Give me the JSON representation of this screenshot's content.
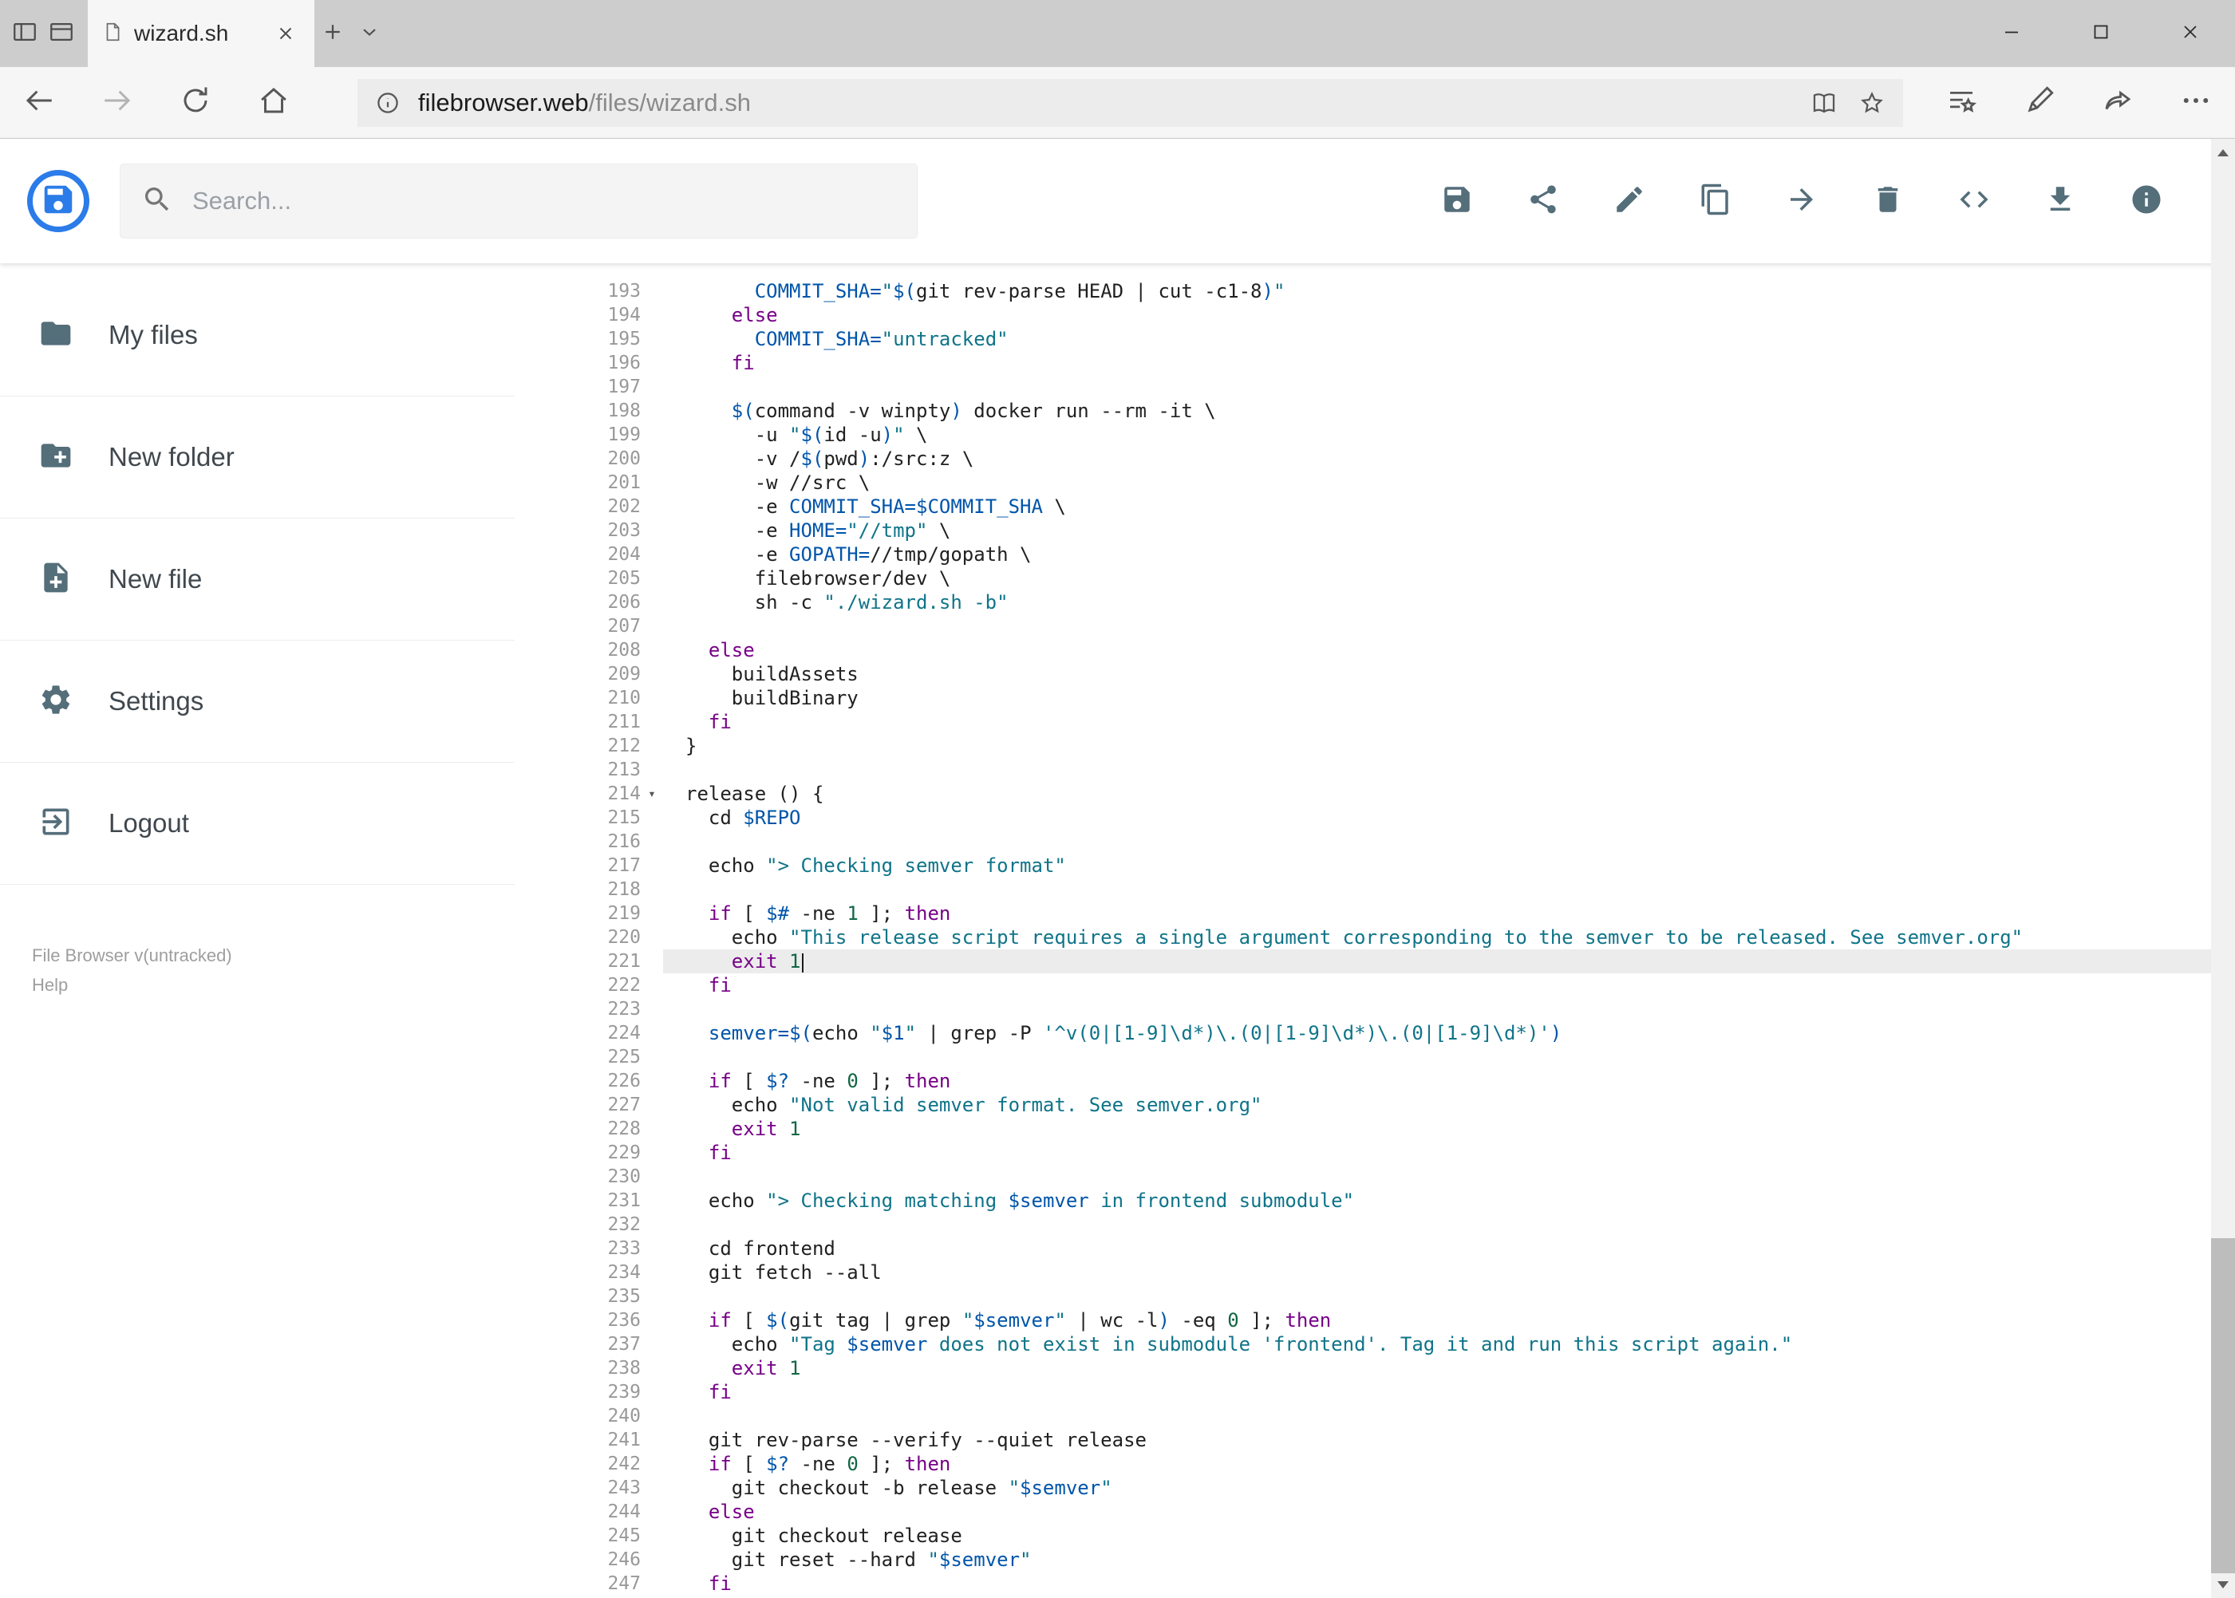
{
  "colors": {
    "accent": "#2b7ce9",
    "toolbar_icon": "#546e7a",
    "syntax_keyword": "#770088",
    "syntax_variable": "#0055aa",
    "syntax_string": "#0f7489",
    "syntax_number": "#116644",
    "active_line_bg": "#ececec"
  },
  "browser": {
    "tab": {
      "title": "wizard.sh"
    },
    "address": {
      "host": "filebrowser.web",
      "path": "/files/wizard.sh"
    },
    "nav_icons": [
      "back",
      "forward",
      "refresh",
      "home"
    ],
    "address_icons": [
      "site-info",
      "reading-view",
      "add-favorite"
    ],
    "action_icons": [
      "hub",
      "web-note",
      "share",
      "more"
    ],
    "window_controls": [
      "minimize",
      "maximize",
      "close"
    ]
  },
  "app": {
    "search_placeholder": "Search...",
    "toolbar_icons": [
      "save",
      "share",
      "rename",
      "copy",
      "move",
      "delete",
      "raw-view",
      "download",
      "info"
    ]
  },
  "sidebar": {
    "items": [
      {
        "label": "My files",
        "icon": "folder"
      },
      {
        "label": "New folder",
        "icon": "create-new-folder"
      },
      {
        "label": "New file",
        "icon": "note-add"
      },
      {
        "label": "Settings",
        "icon": "settings"
      },
      {
        "label": "Logout",
        "icon": "exit"
      }
    ],
    "footer": {
      "version": "File Browser v(untracked)",
      "help": "Help"
    }
  },
  "editor": {
    "first_line": 193,
    "active_line": 221,
    "cursor_line": 221,
    "fold_marker": "▾",
    "lines": [
      {
        "n": 193,
        "t": [
          [
            "p",
            "      "
          ],
          [
            "v",
            "COMMIT_SHA="
          ],
          [
            "s",
            "\""
          ],
          [
            "v",
            "$("
          ],
          [
            "p",
            "git rev-parse HEAD | cut -c1-8"
          ],
          [
            "v",
            ")"
          ],
          [
            "s",
            "\""
          ]
        ]
      },
      {
        "n": 194,
        "t": [
          [
            "p",
            "    "
          ],
          [
            "k",
            "else"
          ]
        ]
      },
      {
        "n": 195,
        "t": [
          [
            "p",
            "      "
          ],
          [
            "v",
            "COMMIT_SHA="
          ],
          [
            "s",
            "\"untracked\""
          ]
        ]
      },
      {
        "n": 196,
        "t": [
          [
            "p",
            "    "
          ],
          [
            "k",
            "fi"
          ]
        ]
      },
      {
        "n": 197,
        "t": []
      },
      {
        "n": 198,
        "t": [
          [
            "p",
            "    "
          ],
          [
            "v",
            "$("
          ],
          [
            "p",
            "command -v winpty"
          ],
          [
            "v",
            ")"
          ],
          [
            "p",
            " docker run --rm -it \\"
          ]
        ]
      },
      {
        "n": 199,
        "t": [
          [
            "p",
            "      -u "
          ],
          [
            "s",
            "\""
          ],
          [
            "v",
            "$("
          ],
          [
            "p",
            "id -u"
          ],
          [
            "v",
            ")"
          ],
          [
            "s",
            "\""
          ],
          [
            "p",
            " \\"
          ]
        ]
      },
      {
        "n": 200,
        "t": [
          [
            "p",
            "      -v /"
          ],
          [
            "v",
            "$("
          ],
          [
            "p",
            "pwd"
          ],
          [
            "v",
            ")"
          ],
          [
            "p",
            ":/src:z \\"
          ]
        ]
      },
      {
        "n": 201,
        "t": [
          [
            "p",
            "      -w //src \\"
          ]
        ]
      },
      {
        "n": 202,
        "t": [
          [
            "p",
            "      -e "
          ],
          [
            "v",
            "COMMIT_SHA="
          ],
          [
            "v",
            "$COMMIT_SHA"
          ],
          [
            "p",
            " \\"
          ]
        ]
      },
      {
        "n": 203,
        "t": [
          [
            "p",
            "      -e "
          ],
          [
            "v",
            "HOME="
          ],
          [
            "s",
            "\"//tmp\""
          ],
          [
            "p",
            " \\"
          ]
        ]
      },
      {
        "n": 204,
        "t": [
          [
            "p",
            "      -e "
          ],
          [
            "v",
            "GOPATH="
          ],
          [
            "p",
            "//tmp/gopath \\"
          ]
        ]
      },
      {
        "n": 205,
        "t": [
          [
            "p",
            "      filebrowser/dev \\"
          ]
        ]
      },
      {
        "n": 206,
        "t": [
          [
            "p",
            "      sh -c "
          ],
          [
            "s",
            "\"./wizard.sh -b\""
          ]
        ]
      },
      {
        "n": 207,
        "t": []
      },
      {
        "n": 208,
        "t": [
          [
            "p",
            "  "
          ],
          [
            "k",
            "else"
          ]
        ]
      },
      {
        "n": 209,
        "t": [
          [
            "p",
            "    buildAssets"
          ]
        ]
      },
      {
        "n": 210,
        "t": [
          [
            "p",
            "    buildBinary"
          ]
        ]
      },
      {
        "n": 211,
        "t": [
          [
            "p",
            "  "
          ],
          [
            "k",
            "fi"
          ]
        ]
      },
      {
        "n": 212,
        "t": [
          [
            "p",
            "}"
          ]
        ]
      },
      {
        "n": 213,
        "t": []
      },
      {
        "n": 214,
        "fold": true,
        "t": [
          [
            "p",
            "release () {"
          ]
        ]
      },
      {
        "n": 215,
        "t": [
          [
            "p",
            "  cd "
          ],
          [
            "v",
            "$REPO"
          ]
        ]
      },
      {
        "n": 216,
        "t": []
      },
      {
        "n": 217,
        "t": [
          [
            "p",
            "  echo "
          ],
          [
            "s",
            "\"> Checking semver format\""
          ]
        ]
      },
      {
        "n": 218,
        "t": []
      },
      {
        "n": 219,
        "t": [
          [
            "p",
            "  "
          ],
          [
            "k",
            "if"
          ],
          [
            "p",
            " [ "
          ],
          [
            "v",
            "$#"
          ],
          [
            "p",
            " -ne "
          ],
          [
            "n",
            "1"
          ],
          [
            "p",
            " ]; "
          ],
          [
            "k",
            "then"
          ]
        ]
      },
      {
        "n": 220,
        "t": [
          [
            "p",
            "    echo "
          ],
          [
            "s",
            "\"This release script requires a single argument corresponding to the semver to be released. See semver.org\""
          ]
        ]
      },
      {
        "n": 221,
        "t": [
          [
            "p",
            "    "
          ],
          [
            "k",
            "exit"
          ],
          [
            "p",
            " "
          ],
          [
            "n",
            "1"
          ]
        ]
      },
      {
        "n": 222,
        "t": [
          [
            "p",
            "  "
          ],
          [
            "k",
            "fi"
          ]
        ]
      },
      {
        "n": 223,
        "t": []
      },
      {
        "n": 224,
        "t": [
          [
            "p",
            "  "
          ],
          [
            "v",
            "semver="
          ],
          [
            "v",
            "$("
          ],
          [
            "p",
            "echo "
          ],
          [
            "s",
            "\""
          ],
          [
            "v",
            "$1"
          ],
          [
            "s",
            "\""
          ],
          [
            "p",
            " | grep -P "
          ],
          [
            "s",
            "'^v(0|[1-9]\\d*)\\.(0|[1-9]\\d*)\\.(0|[1-9]\\d*)'"
          ],
          [
            "v",
            ")"
          ]
        ]
      },
      {
        "n": 225,
        "t": []
      },
      {
        "n": 226,
        "t": [
          [
            "p",
            "  "
          ],
          [
            "k",
            "if"
          ],
          [
            "p",
            " [ "
          ],
          [
            "v",
            "$?"
          ],
          [
            "p",
            " -ne "
          ],
          [
            "n",
            "0"
          ],
          [
            "p",
            " ]; "
          ],
          [
            "k",
            "then"
          ]
        ]
      },
      {
        "n": 227,
        "t": [
          [
            "p",
            "    echo "
          ],
          [
            "s",
            "\"Not valid semver format. See semver.org\""
          ]
        ]
      },
      {
        "n": 228,
        "t": [
          [
            "p",
            "    "
          ],
          [
            "k",
            "exit"
          ],
          [
            "p",
            " "
          ],
          [
            "n",
            "1"
          ]
        ]
      },
      {
        "n": 229,
        "t": [
          [
            "p",
            "  "
          ],
          [
            "k",
            "fi"
          ]
        ]
      },
      {
        "n": 230,
        "t": []
      },
      {
        "n": 231,
        "t": [
          [
            "p",
            "  echo "
          ],
          [
            "s",
            "\"> Checking matching "
          ],
          [
            "v",
            "$semver"
          ],
          [
            "s",
            " in frontend submodule\""
          ]
        ]
      },
      {
        "n": 232,
        "t": []
      },
      {
        "n": 233,
        "t": [
          [
            "p",
            "  cd frontend"
          ]
        ]
      },
      {
        "n": 234,
        "t": [
          [
            "p",
            "  git fetch --all"
          ]
        ]
      },
      {
        "n": 235,
        "t": []
      },
      {
        "n": 236,
        "t": [
          [
            "p",
            "  "
          ],
          [
            "k",
            "if"
          ],
          [
            "p",
            " [ "
          ],
          [
            "v",
            "$("
          ],
          [
            "p",
            "git tag | grep "
          ],
          [
            "s",
            "\""
          ],
          [
            "v",
            "$semver"
          ],
          [
            "s",
            "\""
          ],
          [
            "p",
            " | wc -l"
          ],
          [
            "v",
            ")"
          ],
          [
            "p",
            " -eq "
          ],
          [
            "n",
            "0"
          ],
          [
            "p",
            " ]; "
          ],
          [
            "k",
            "then"
          ]
        ]
      },
      {
        "n": 237,
        "t": [
          [
            "p",
            "    echo "
          ],
          [
            "s",
            "\"Tag "
          ],
          [
            "v",
            "$semver"
          ],
          [
            "s",
            " does not exist in submodule 'frontend'. Tag it and run this script again.\""
          ]
        ]
      },
      {
        "n": 238,
        "t": [
          [
            "p",
            "    "
          ],
          [
            "k",
            "exit"
          ],
          [
            "p",
            " "
          ],
          [
            "n",
            "1"
          ]
        ]
      },
      {
        "n": 239,
        "t": [
          [
            "p",
            "  "
          ],
          [
            "k",
            "fi"
          ]
        ]
      },
      {
        "n": 240,
        "t": []
      },
      {
        "n": 241,
        "t": [
          [
            "p",
            "  git rev-parse --verify --quiet release"
          ]
        ]
      },
      {
        "n": 242,
        "t": [
          [
            "p",
            "  "
          ],
          [
            "k",
            "if"
          ],
          [
            "p",
            " [ "
          ],
          [
            "v",
            "$?"
          ],
          [
            "p",
            " -ne "
          ],
          [
            "n",
            "0"
          ],
          [
            "p",
            " ]; "
          ],
          [
            "k",
            "then"
          ]
        ]
      },
      {
        "n": 243,
        "t": [
          [
            "p",
            "    git checkout -b release "
          ],
          [
            "s",
            "\""
          ],
          [
            "v",
            "$semver"
          ],
          [
            "s",
            "\""
          ]
        ]
      },
      {
        "n": 244,
        "t": [
          [
            "p",
            "  "
          ],
          [
            "k",
            "else"
          ]
        ]
      },
      {
        "n": 245,
        "t": [
          [
            "p",
            "    git checkout release"
          ]
        ]
      },
      {
        "n": 246,
        "t": [
          [
            "p",
            "    git reset --hard "
          ],
          [
            "s",
            "\""
          ],
          [
            "v",
            "$semver"
          ],
          [
            "s",
            "\""
          ]
        ]
      },
      {
        "n": 247,
        "t": [
          [
            "p",
            "  "
          ],
          [
            "k",
            "fi"
          ]
        ]
      }
    ]
  }
}
